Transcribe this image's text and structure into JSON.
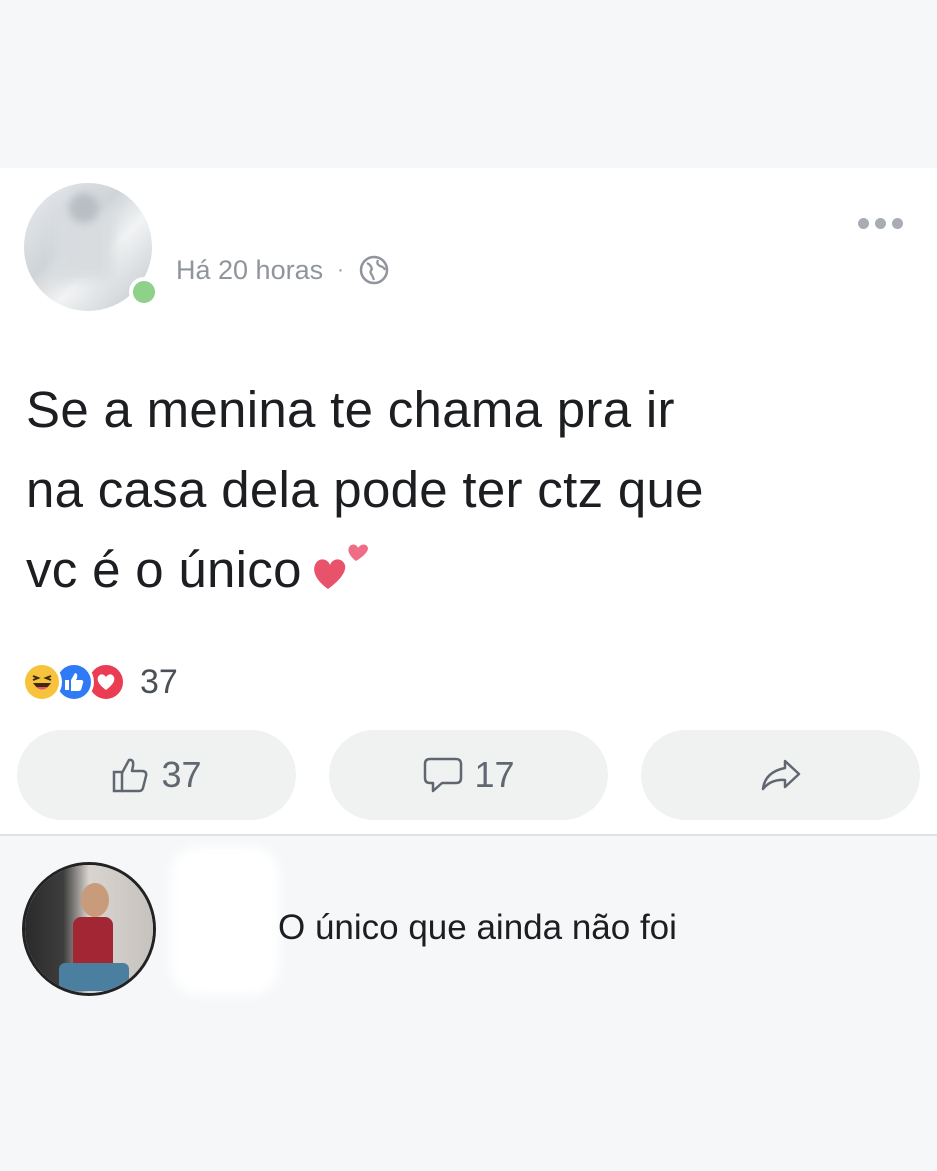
{
  "post": {
    "timestamp": "Há 20 horas",
    "separator": "·",
    "privacy_icon": "globe-icon",
    "more_icon": "more-dots-icon",
    "text_lines": [
      "Se a menina  te chama pra ir",
      "na casa dela pode ter ctz que",
      "vc é o único"
    ],
    "emoji": "two-hearts-emoji"
  },
  "reactions": {
    "icons": [
      "haha-icon",
      "like-icon",
      "love-icon"
    ],
    "count": "37"
  },
  "actions": {
    "like_count": "37",
    "comment_count": "17"
  },
  "comment": {
    "text": "O único que ainda não foi"
  },
  "colors": {
    "background": "#f5f7f8",
    "card": "#ffffff",
    "online": "#8dd18a",
    "like_blue": "#2f7bf5",
    "love_red": "#ea3d53",
    "haha_yellow": "#f7c33d",
    "button_bg": "#f0f2f2"
  }
}
